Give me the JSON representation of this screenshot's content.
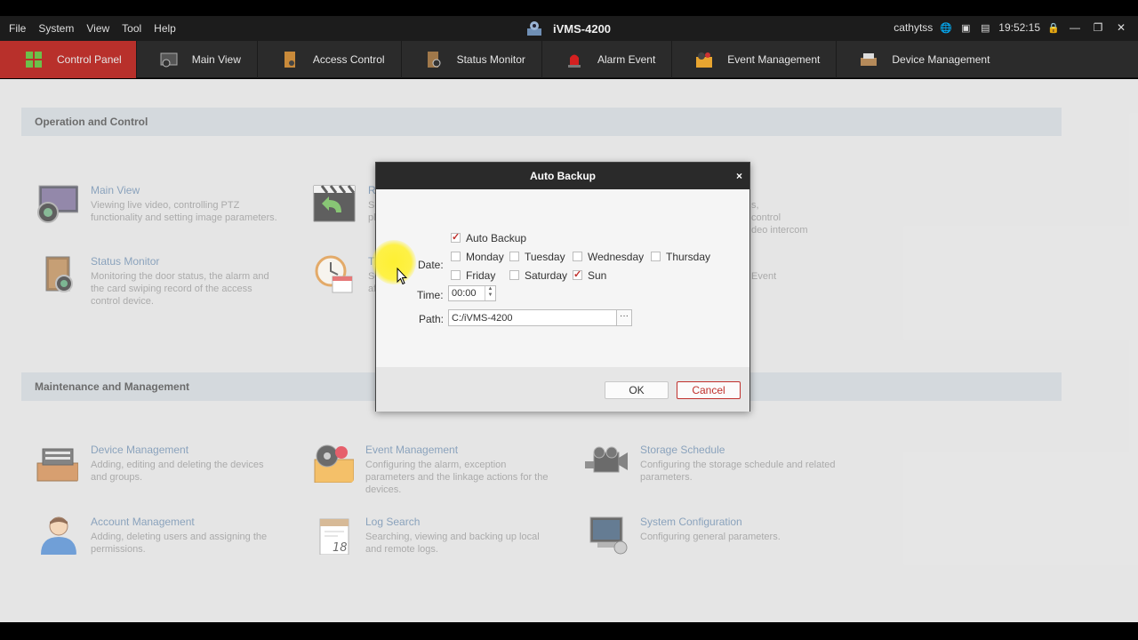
{
  "menubar": {
    "menus": [
      "File",
      "System",
      "View",
      "Tool",
      "Help"
    ],
    "app_title": "iVMS-4200",
    "user": "cathytss",
    "time": "19:52:15"
  },
  "nav": {
    "tabs": [
      {
        "label": "Control Panel",
        "icon": "control-panel-icon",
        "active": true
      },
      {
        "label": "Main View",
        "icon": "main-view-icon"
      },
      {
        "label": "Access Control",
        "icon": "access-control-icon"
      },
      {
        "label": "Status Monitor",
        "icon": "status-monitor-icon"
      },
      {
        "label": "Alarm Event",
        "icon": "alarm-event-icon"
      },
      {
        "label": "Event Management",
        "icon": "event-management-icon"
      },
      {
        "label": "Device Management",
        "icon": "device-management-icon"
      }
    ]
  },
  "sections": {
    "operation": "Operation and Control",
    "maintenance": "Maintenance and Management"
  },
  "operation_items": {
    "main_view": {
      "title": "Main View",
      "desc": "Viewing live video, controlling PTZ functionality and setting image parameters."
    },
    "status_monitor": {
      "title": "Status Monitor",
      "desc": "Monitoring the door status, the alarm and the card swiping record of the access control device."
    },
    "remote_title_partial": "Re",
    "remote_desc_partial": "Se\npl",
    "time_title_partial": "Ti",
    "time_desc_partial": "Se\naf",
    "right_desc_partial": "s,\ncontrol\ndeo intercom",
    "right_event_partial": "Event"
  },
  "maintenance_items": {
    "device_management": {
      "title": "Device Management",
      "desc": "Adding, editing and deleting the devices and groups."
    },
    "event_management": {
      "title": "Event Management",
      "desc": "Configuring the alarm, exception parameters and the linkage actions for the devices."
    },
    "storage_schedule": {
      "title": "Storage Schedule",
      "desc": "Configuring the storage schedule and related parameters."
    },
    "account_management": {
      "title": "Account Management",
      "desc": "Adding, deleting users and assigning the permissions."
    },
    "log_search": {
      "title": "Log Search",
      "desc": "Searching, viewing and backing up local and remote logs."
    },
    "system_configuration": {
      "title": "System Configuration",
      "desc": "Configuring general parameters."
    }
  },
  "dialog": {
    "title": "Auto Backup",
    "close": "×",
    "auto_backup_label": "Auto Backup",
    "auto_backup_checked": true,
    "date_label": "Date:",
    "days": [
      {
        "label": "Monday",
        "checked": false
      },
      {
        "label": "Tuesday",
        "checked": false
      },
      {
        "label": "Wednesday",
        "checked": false
      },
      {
        "label": "Thursday",
        "checked": false
      },
      {
        "label": "Friday",
        "checked": false
      },
      {
        "label": "Saturday",
        "checked": false
      },
      {
        "label": "Sun",
        "checked": true
      }
    ],
    "time_label": "Time:",
    "time_value": "00:00",
    "path_label": "Path:",
    "path_value": "C:/iVMS-4200",
    "browse": "···",
    "ok": "OK",
    "cancel": "Cancel"
  },
  "colors": {
    "accent": "#b8302b",
    "link": "#5d7fa3",
    "section_bg": "#c4cbd0"
  }
}
